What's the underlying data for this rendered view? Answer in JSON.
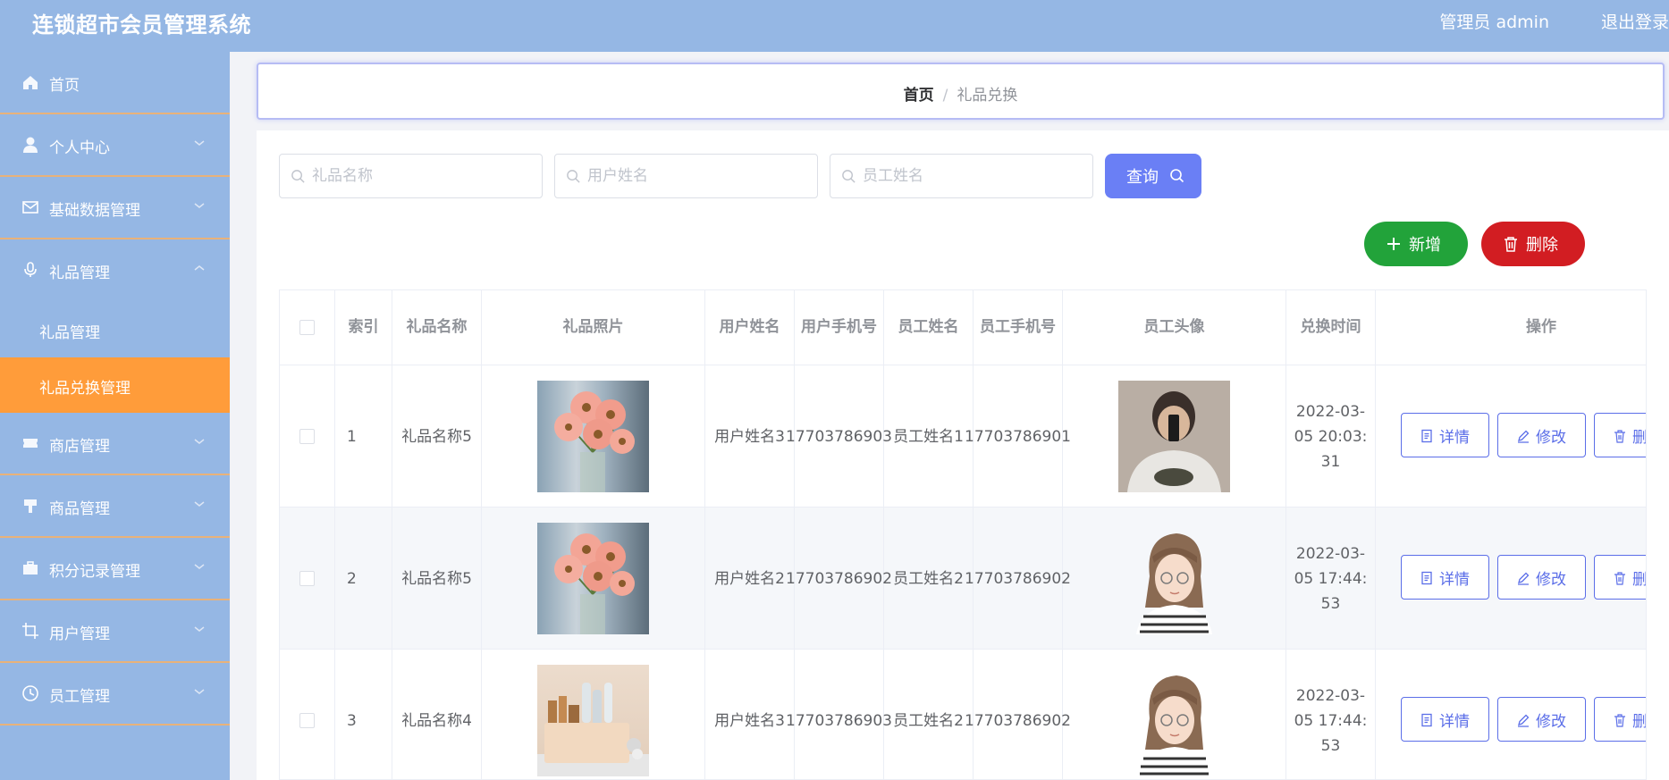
{
  "app": {
    "title": "连锁超市会员管理系统",
    "user_label": "管理员 admin",
    "logout_label": "退出登录"
  },
  "sidebar": {
    "items": [
      {
        "label": "首页",
        "icon": "home-icon"
      },
      {
        "label": "个人中心",
        "icon": "user-icon",
        "expandable": true
      },
      {
        "label": "基础数据管理",
        "icon": "mail-icon",
        "expandable": true
      },
      {
        "label": "礼品管理",
        "icon": "microphone-icon",
        "expandable": true,
        "expanded": true
      },
      {
        "label": "商店管理",
        "icon": "ticket-icon",
        "expandable": true
      },
      {
        "label": "商品管理",
        "icon": "stamp-icon",
        "expandable": true
      },
      {
        "label": "积分记录管理",
        "icon": "briefcase-icon",
        "expandable": true
      },
      {
        "label": "用户管理",
        "icon": "crop-icon",
        "expandable": true
      },
      {
        "label": "员工管理",
        "icon": "clock-icon",
        "expandable": true
      }
    ],
    "subitems": [
      {
        "label": "礼品管理",
        "active": false
      },
      {
        "label": "礼品兑换管理",
        "active": true
      }
    ]
  },
  "breadcrumb": {
    "home": "首页",
    "separator": "/",
    "current": "礼品兑换"
  },
  "search": {
    "gift_name_placeholder": "礼品名称",
    "user_name_placeholder": "用户姓名",
    "staff_name_placeholder": "员工姓名",
    "query_label": "查询"
  },
  "actions": {
    "add_label": "新增",
    "delete_label": "删除"
  },
  "table": {
    "headers": {
      "index": "索引",
      "gift_name": "礼品名称",
      "gift_photo": "礼品照片",
      "user_name": "用户姓名",
      "user_phone": "用户手机号",
      "staff_name": "员工姓名",
      "staff_phone": "员工手机号",
      "staff_avatar": "员工头像",
      "exchange_time": "兑换时间",
      "operation": "操作"
    },
    "rows": [
      {
        "index": "1",
        "gift_name": "礼品名称5",
        "gift_photo": "flowers",
        "user_name": "用户姓名3",
        "user_phone": "17703786903",
        "staff_name": "员工姓名1",
        "staff_phone": "17703786901",
        "staff_avatar": "photo",
        "exchange_time": "2022-03-05 20:03:31"
      },
      {
        "index": "2",
        "gift_name": "礼品名称5",
        "gift_photo": "flowers",
        "user_name": "用户姓名2",
        "user_phone": "17703786902",
        "staff_name": "员工姓名2",
        "staff_phone": "17703786902",
        "staff_avatar": "cartoon",
        "exchange_time": "2022-03-05 17:44:53"
      },
      {
        "index": "3",
        "gift_name": "礼品名称4",
        "gift_photo": "gifts",
        "user_name": "用户姓名3",
        "user_phone": "17703786903",
        "staff_name": "员工姓名2",
        "staff_phone": "17703786902",
        "staff_avatar": "cartoon",
        "exchange_time": "2022-03-05 17:44:53"
      }
    ],
    "row_actions": {
      "detail": "详情",
      "edit": "修改",
      "delete": "删除"
    }
  },
  "colors": {
    "header_bg": "#95b7e4",
    "sidebar_bg": "#95b7e4",
    "active_menu": "#ff9c3a",
    "primary": "#6a7ff5",
    "success": "#22a33a",
    "danger": "#d21d22"
  }
}
